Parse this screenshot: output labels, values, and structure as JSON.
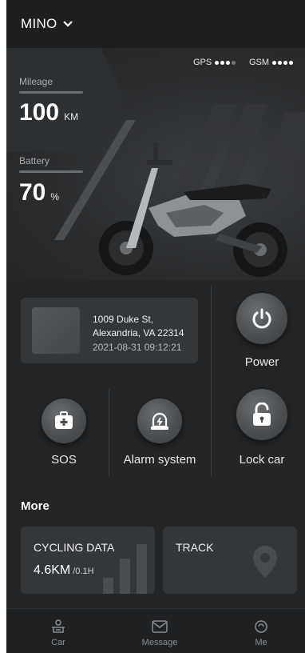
{
  "header": {
    "device_name": "MINO"
  },
  "status": {
    "gps_label": "GPS",
    "gsm_label": "GSM",
    "gps_level": 3,
    "gsm_level": 4,
    "max_level": 4
  },
  "stats": {
    "mileage": {
      "label": "Mileage",
      "value": "100",
      "unit": "KM"
    },
    "battery": {
      "label": "Battery",
      "value": "70",
      "unit": "%"
    }
  },
  "location": {
    "line1": "1009 Duke St,",
    "line2": "Alexandria, VA 22314",
    "time": "2021-08-31 09:12:21"
  },
  "controls": {
    "power": "Power",
    "sos": "SOS",
    "alarm": "Alarm system",
    "lock": "Lock car"
  },
  "more": {
    "title": "More",
    "cycling": {
      "title": "CYCLING DATA",
      "value": "4.6KM",
      "unit": "/0.1H"
    },
    "track": {
      "title": "TRACK"
    }
  },
  "tabs": [
    {
      "label": "Car",
      "icon": "car-icon"
    },
    {
      "label": "Message",
      "icon": "mail-icon"
    },
    {
      "label": "Me",
      "icon": "person-icon"
    }
  ],
  "colors": {
    "background": "#232527",
    "card": "#34373a",
    "accent": "#ffffff"
  }
}
